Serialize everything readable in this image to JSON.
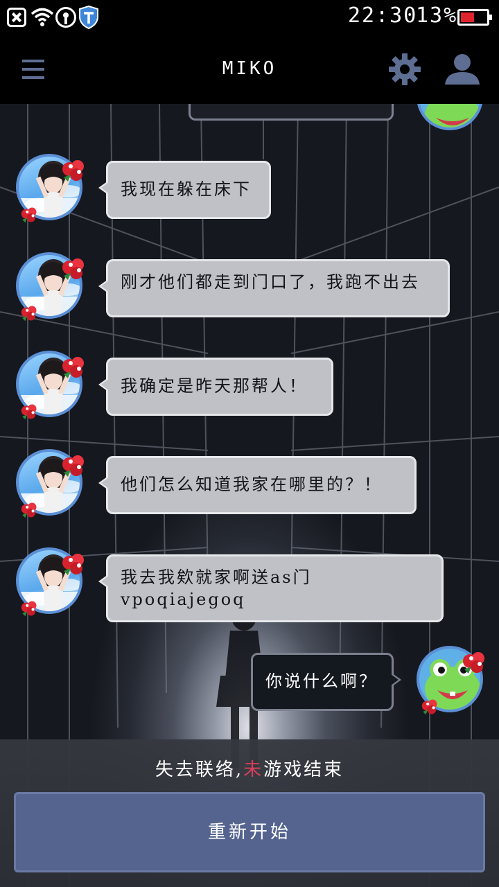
{
  "status_bar": {
    "time": "22:30",
    "battery": "13%",
    "battery_level": 0.13,
    "icons": [
      "close-box-icon",
      "wifi-icon",
      "radio-icon",
      "shield-icon"
    ]
  },
  "header": {
    "title": "MIKO",
    "icons": [
      "menu-icon",
      "gear-icon",
      "profile-icon"
    ]
  },
  "messages": [
    {
      "sender": "miko",
      "text": "我现在躲在床下"
    },
    {
      "sender": "miko",
      "text": "刚才他们都走到门口了，我跑不出去"
    },
    {
      "sender": "miko",
      "text": "我确定是昨天那帮人！"
    },
    {
      "sender": "miko",
      "text": "他们怎么知道我家在哪里的？！"
    },
    {
      "sender": "miko",
      "text": "我去我欸就家啊送as门vpoqiajegoq"
    },
    {
      "sender": "me",
      "text": "你说什么啊？"
    }
  ],
  "footer": {
    "status_prefix": "失去联络,",
    "status_accent": "未",
    "status_suffix": "游戏结束",
    "restart_label": "重新开始"
  },
  "colors": {
    "header_bg": "#000000",
    "accent_icon": "#5d6e92",
    "incoming_bubble": "#bfc1c6",
    "outgoing_bubble": "#14181f",
    "restart_button": "#54648f",
    "battery_low": "#e0242c"
  }
}
